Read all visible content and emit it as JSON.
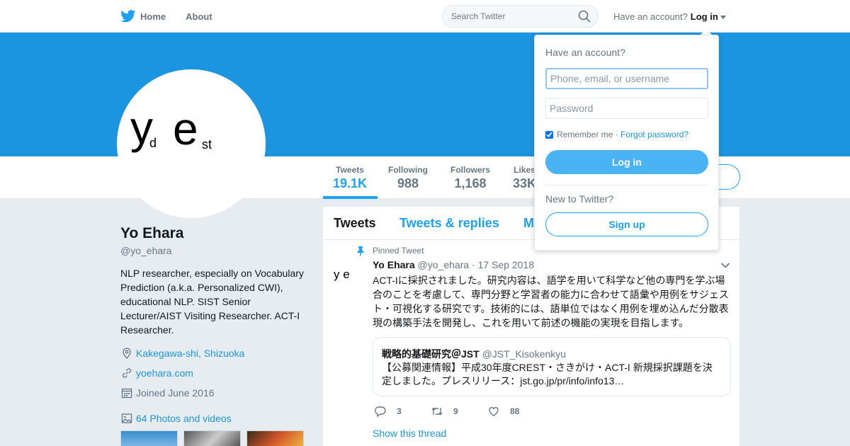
{
  "nav": {
    "home": "Home",
    "about": "About",
    "search_placeholder": "Search Twitter",
    "have_account": "Have an account?",
    "login": "Log in"
  },
  "avatar_text": {
    "y": "y",
    "d": "d",
    "e": "e",
    "st": "st"
  },
  "stats": [
    {
      "label": "Tweets",
      "value": "19.1K"
    },
    {
      "label": "Following",
      "value": "988"
    },
    {
      "label": "Followers",
      "value": "1,168"
    },
    {
      "label": "Likes",
      "value": "33K"
    }
  ],
  "profile": {
    "name": "Yo Ehara",
    "handle": "@yo_ehara",
    "bio": "NLP researcher, especially on Vocabulary Prediction (a.k.a. Personalized CWI), educational NLP. SIST Senior Lecturer/AIST Visiting Researcher. ACT-I Researcher.",
    "location": "Kakegawa-shi, Shizuoka",
    "website": "yoehara.com",
    "joined": "Joined June 2016",
    "photos": "64 Photos and videos"
  },
  "tabs": [
    "Tweets",
    "Tweets & replies",
    "M"
  ],
  "tweet": {
    "pinned_label": "Pinned Tweet",
    "avatar_text": "y e",
    "name": "Yo Ehara",
    "handle": "@yo_ehara",
    "date": "· 17 Sep 2018",
    "text": "ACT-Iに採択されました。研究内容は、語学を用いて科学など他の専門を学ぶ場合のことを考慮して、専門分野と学習者の能力に合わせて語彙や用例をサジェスト・可視化する研究です。技術的には、語単位ではなく用例を埋め込んだ分散表現の構築手法を開発し、これを用いて前述の機能の実現を目指します。",
    "quote": {
      "name": "戦略的基礎研究＠JST",
      "handle": "@JST_Kisokenkyu",
      "text": "【公募関連情報】平成30年度CREST・さきがけ・ACT-I 新規採択課題を決定しました。プレスリリース：jst.go.jp/pr/info/info13…"
    },
    "replies": "3",
    "retweets": "9",
    "likes": "88",
    "show_thread": "Show this thread"
  },
  "login_dropdown": {
    "title": "Have an account?",
    "username_placeholder": "Phone, email, or username",
    "password_placeholder": "Password",
    "remember": "Remember me ·",
    "forgot": "Forgot password?",
    "login_button": "Log in",
    "new_label": "New to Twitter?",
    "signup_button": "Sign up"
  },
  "colors": {
    "brand": "#1da1f2",
    "banner": "#1b95e0",
    "link": "#1b95e0",
    "background": "#e6ecf0"
  }
}
